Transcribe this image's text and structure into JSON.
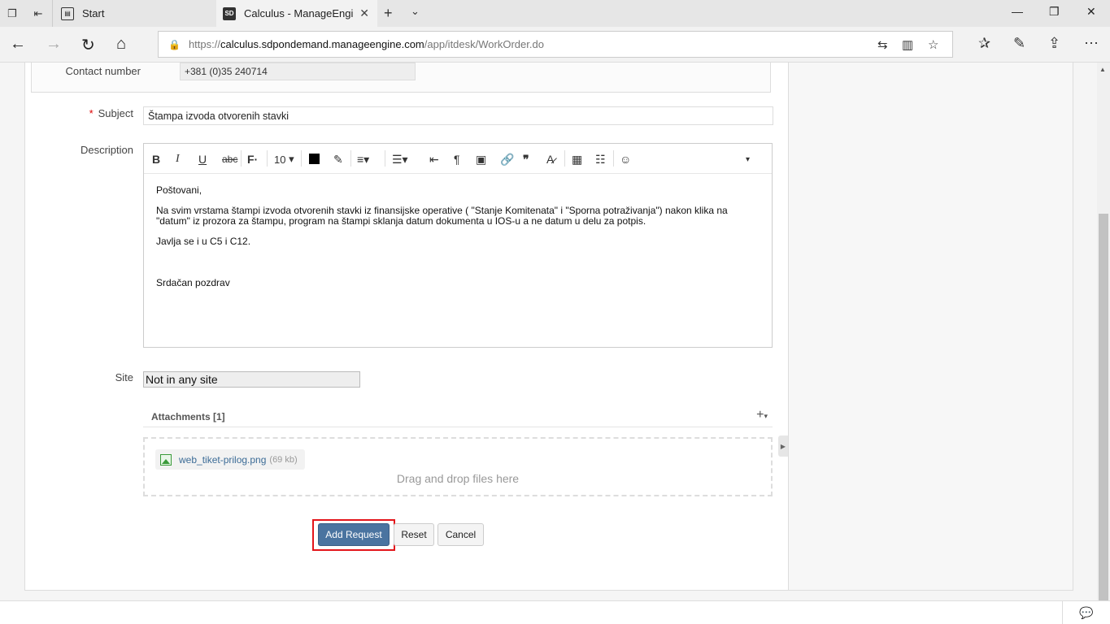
{
  "browser": {
    "tabs": [
      {
        "label": "Start",
        "icon": "page-icon"
      },
      {
        "label": "Calculus - ManageEngi",
        "icon": "sd-favicon",
        "favicon_text": "SD"
      }
    ],
    "url": {
      "scheme": "https://",
      "host": "calculus.sdpondemand.manageengine.com",
      "path": "/app/itdesk/WorkOrder.do"
    }
  },
  "form": {
    "contact": {
      "label": "Contact number",
      "value": "+381 (0)35 240714"
    },
    "subject": {
      "required_mark": "*",
      "label": "Subject",
      "value": "Štampa izvoda otvorenih stavki"
    },
    "description": {
      "label": "Description",
      "toolbar": {
        "font_size": "10"
      },
      "paragraphs": [
        "Poštovani,",
        "Na svim vrstama štampi izvoda otvorenih stavki iz finansijske operative ( \"Stanje Komitenata\" i \"Sporna potraživanja\") nakon klika na \"datum\" iz prozora za štampu, program na štampi sklanja datum dokumenta u IOS-u a ne datum u delu za potpis.",
        "Javlja se i u C5 i C12.",
        "",
        "Srdačan pozdrav"
      ]
    },
    "site": {
      "label": "Site",
      "value": "Not in any site"
    },
    "attachments": {
      "title": "Attachments [1]",
      "file": {
        "name": "web_tiket-prilog.png",
        "size": "(69 kb)"
      },
      "drop_text": "Drag and drop files here"
    },
    "buttons": {
      "add": "Add Request",
      "reset": "Reset",
      "cancel": "Cancel"
    }
  },
  "colors": {
    "primary_button": "#4a74a0",
    "highlight": "#e3151a",
    "required": "#dd0000"
  }
}
